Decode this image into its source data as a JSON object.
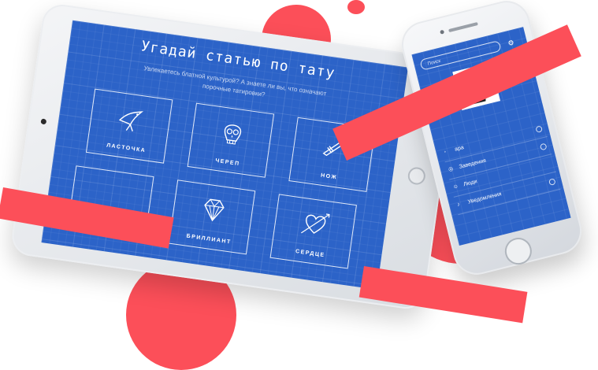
{
  "colors": {
    "accent": "#fc4f59",
    "blue": "#2c63c8",
    "white": "#ffffff"
  },
  "tablet": {
    "title": "Угадай статью по тату",
    "subtitle": "Увлекаетесь блатной культурой? А знаете ли вы, что означают порочные татировки?",
    "cards": [
      {
        "label": "ЛАСТОЧКА",
        "icon": "swallow-icon"
      },
      {
        "label": "ЧЕРЕП",
        "icon": "skull-icon"
      },
      {
        "label": "НОЖ",
        "icon": "knife-icon"
      },
      {
        "label": "",
        "icon": "partial-icon"
      },
      {
        "label": "БРИЛЛИАНТ",
        "icon": "diamond-icon"
      },
      {
        "label": "СЕРДЦЕ",
        "icon": "heart-arrow-icon"
      }
    ]
  },
  "phone": {
    "search_placeholder": "Поиск",
    "settings_icon": "gear-icon",
    "menu": [
      {
        "label": "ара",
        "icon": "user-icon"
      },
      {
        "label": "Заведения",
        "icon": "place-icon"
      },
      {
        "label": "Люди",
        "icon": "people-icon"
      },
      {
        "label": "Уведомления",
        "icon": "bell-icon"
      }
    ]
  }
}
